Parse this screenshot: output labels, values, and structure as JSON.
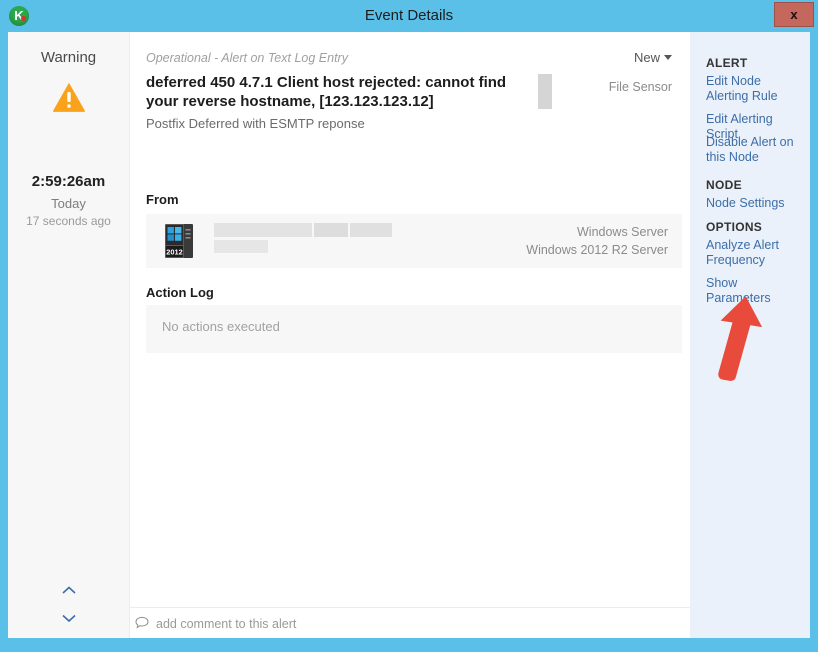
{
  "window": {
    "title": "Event Details",
    "logo_icon": "kaseya-k-logo-icon",
    "close_label": "x",
    "accent_color": "#5bc0e8",
    "close_button_color": "#c4675d"
  },
  "status": {
    "severity": "Warning",
    "severity_icon": "warning-triangle-icon",
    "severity_color": "#faa21b",
    "time": "2:59:26am",
    "day": "Today",
    "relative": "17 seconds ago",
    "prev_icon": "chevron-up-icon",
    "next_icon": "chevron-down-icon"
  },
  "event": {
    "category": "Operational - Alert on Text Log Entry",
    "state": "New",
    "state_caret_icon": "chevron-down-icon",
    "title": "deferred 450 4.7.1 Client host rejected: cannot find your reverse hostname, [123.123.123.12]",
    "subtitle": "Postfix Deferred with ESMTP reponse",
    "sensor_type": "File Sensor"
  },
  "from": {
    "heading": "From",
    "node_icon": "windows-2012-server-icon",
    "os_name": "Windows Server",
    "os_version": "Windows 2012 R2 Server"
  },
  "action_log": {
    "heading": "Action Log",
    "empty_text": "No actions executed"
  },
  "comment": {
    "icon": "comment-bubble-icon",
    "placeholder": "add comment to this alert"
  },
  "actions": {
    "alert_group": "ALERT",
    "edit_node_alerting_rule": "Edit Node Alerting Rule",
    "edit_alerting_script": "Edit Alerting Script",
    "disable_alert_on_node": "Disable Alert on this Node",
    "node_group": "NODE",
    "node_settings": "Node Settings",
    "options_group": "OPTIONS",
    "analyze_alert_frequency": "Analyze Alert Frequency",
    "show_parameters": "Show Parameters",
    "callout_icon": "red-arrow-annotation-icon",
    "callout_color": "#e84b3c"
  }
}
